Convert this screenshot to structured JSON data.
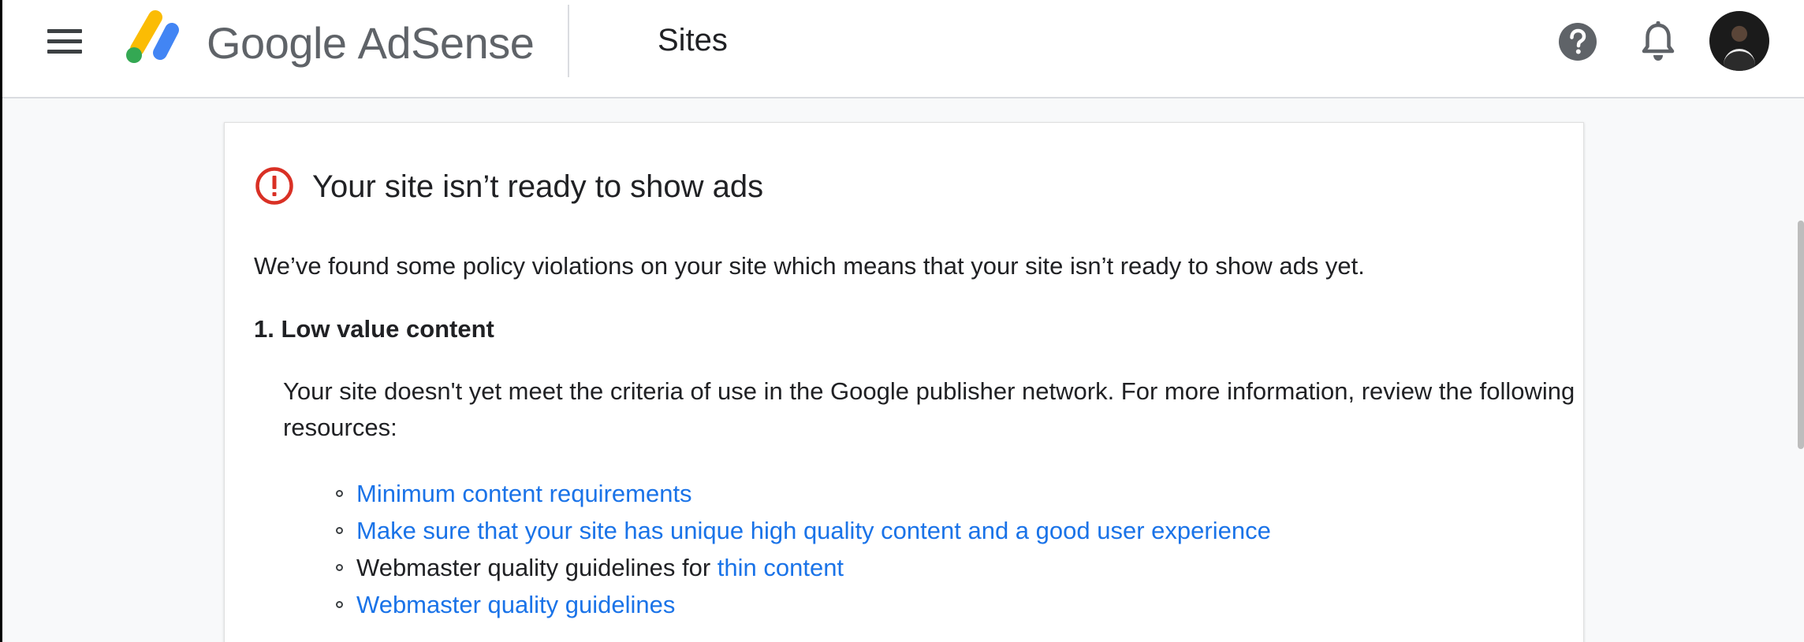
{
  "header": {
    "menu_icon": "hamburger-menu-icon",
    "logo_icon": "adsense-logo-icon",
    "logo_google": "Google",
    "logo_product": "AdSense",
    "section_title": "Sites",
    "help_icon": "help-icon",
    "notifications_icon": "bell-icon",
    "avatar_icon": "user-avatar"
  },
  "alert": {
    "icon": "error-icon",
    "icon_color": "#d93025",
    "title": "Your site isn’t ready to show ads",
    "description": "We’ve found some policy violations on your site which means that your site isn’t ready to show ads yet.",
    "violations": [
      {
        "heading": "1. Low value content",
        "body": "Your site doesn't yet meet the criteria of use in the Google publisher network. For more information, review the following resources:",
        "resources": [
          {
            "prefix": "",
            "link": "Minimum content requirements"
          },
          {
            "prefix": "",
            "link": "Make sure that your site has unique high quality content and a good user experience"
          },
          {
            "prefix": "Webmaster quality guidelines for ",
            "link": "thin content"
          },
          {
            "prefix": "",
            "link": "Webmaster quality guidelines"
          }
        ]
      }
    ]
  },
  "colors": {
    "link": "#1a73e8",
    "text": "#202124",
    "logo_yellow": "#fbbc04",
    "logo_blue": "#4285f4",
    "logo_green": "#34a853"
  }
}
